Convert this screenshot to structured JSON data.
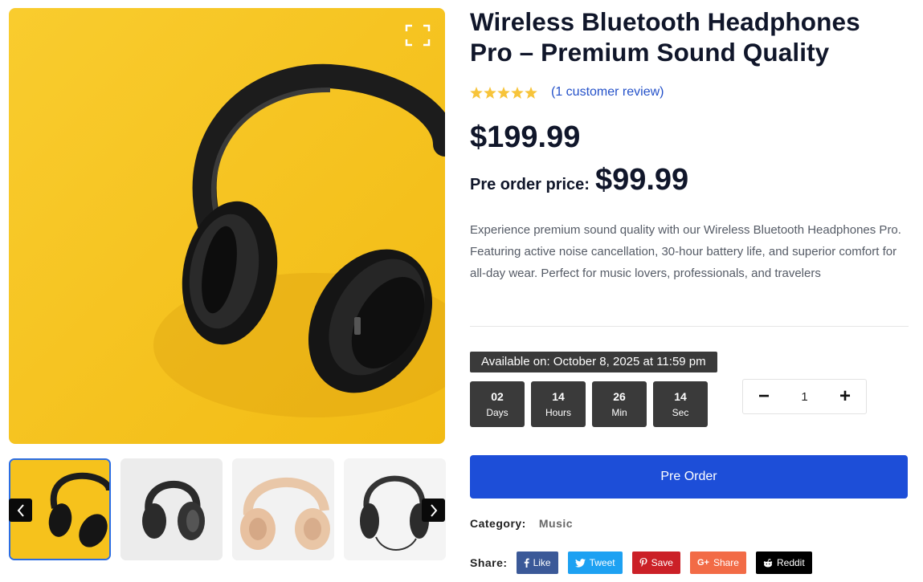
{
  "product": {
    "title": "Wireless Bluetooth Headphones Pro – Premium Sound Quality",
    "rating": 5,
    "review_link": "(1 customer review)",
    "price": "$199.99",
    "preorder_label": "Pre order price:",
    "preorder_price": "$99.99",
    "description": "Experience premium sound quality with our Wireless Bluetooth Headphones Pro. Featuring active noise cancellation, 30-hour battery life, and superior comfort for all-day wear. Perfect for music lovers, professionals, and travelers"
  },
  "availability": {
    "text": "Available on: October 8, 2025 at 11:59 pm"
  },
  "countdown": [
    {
      "value": "02",
      "label": "Days"
    },
    {
      "value": "14",
      "label": "Hours"
    },
    {
      "value": "26",
      "label": "Min"
    },
    {
      "value": "14",
      "label": "Sec"
    }
  ],
  "quantity": {
    "minus": "−",
    "value": "1",
    "plus": "+"
  },
  "preorder_button": "Pre Order",
  "category": {
    "label": "Category:",
    "value": "Music"
  },
  "share": {
    "label": "Share:",
    "buttons": [
      {
        "label": "Like",
        "icon": "facebook-icon",
        "color": "#3b5998"
      },
      {
        "label": "Tweet",
        "icon": "twitter-icon",
        "color": "#1da1f2"
      },
      {
        "label": "Save",
        "icon": "pinterest-icon",
        "color": "#cb2027"
      },
      {
        "label": "Share",
        "icon": "google-plus-icon",
        "color": "#f26b46"
      },
      {
        "label": "Reddit",
        "icon": "reddit-icon",
        "color": "#000000"
      }
    ]
  },
  "colors": {
    "accent": "#1d4ed8",
    "countdown_bg": "#3a3a3a",
    "star": "#f7c43a",
    "image_bg": "#f6c21c"
  }
}
